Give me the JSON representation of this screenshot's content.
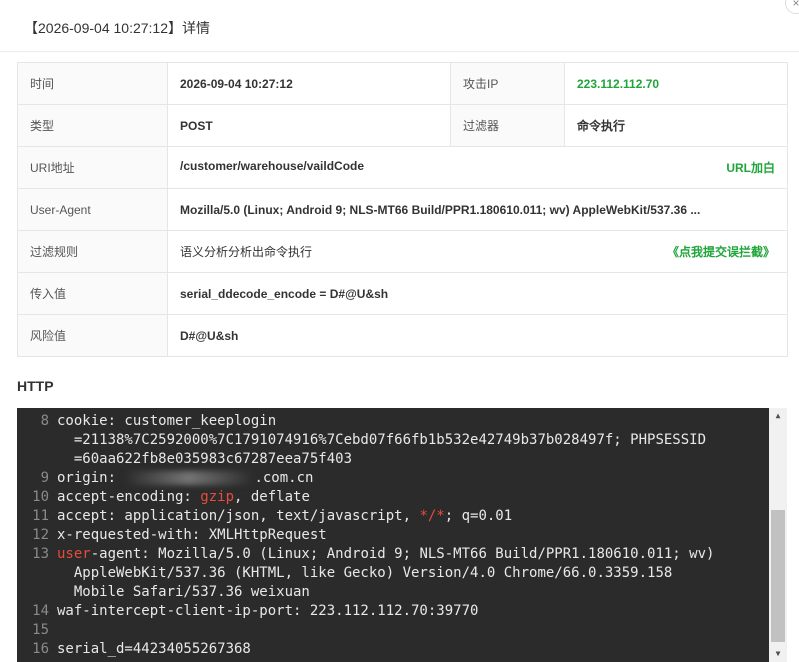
{
  "background": {
    "text": "..."
  },
  "modal": {
    "title": "【2026-09-04 10:27:12】详情",
    "close_icon": "×"
  },
  "details": {
    "time_label": "时间",
    "time_value": "2026-09-04 10:27:12",
    "attack_ip_label": "攻击IP",
    "attack_ip_value": "223.112.112.70",
    "type_label": "类型",
    "type_value": "POST",
    "filter_label": "过滤器",
    "filter_value": "命令执行",
    "uri_label": "URI地址",
    "uri_value": "/customer/warehouse/vaildCode",
    "uri_action": "URL加白",
    "ua_label": "User-Agent",
    "ua_value": "Mozilla/5.0 (Linux; Android 9; NLS-MT66 Build/PPR1.180610.011; wv) AppleWebKit/537.36 ...",
    "rule_label": "过滤规则",
    "rule_value": "语义分析分析出命令执行",
    "rule_action": "《点我提交误拦截》",
    "input_label": "传入值",
    "input_value": "serial_ddecode_encode = D#@U&sh",
    "risk_label": "风险值",
    "risk_value": "D#@U&sh"
  },
  "http": {
    "title": "HTTP",
    "lines": [
      {
        "n": "8",
        "text": "cookie: customer_keeplogin\n  =21138%7C2592000%7C1791074916%7Cebd07f66fb1b532e42749b37b028497f; PHPSESSID\n  =60aa622fb8e035983c67287eea75f403"
      },
      {
        "n": "9",
        "pre": "origin: ",
        "post": ".com.cn"
      },
      {
        "n": "10",
        "pre": "accept-encoding: ",
        "red": "gzip",
        "post": ", deflate"
      },
      {
        "n": "11",
        "pre": "accept: application/json, text/javascript, ",
        "red": "*/*",
        "post": "; q=0.01"
      },
      {
        "n": "12",
        "text": "x-requested-with: XMLHttpRequest"
      },
      {
        "n": "13",
        "red": "user",
        "post": "-agent: Mozilla/5.0 (Linux; Android 9; NLS-MT66 Build/PPR1.180610.011; wv)\n  AppleWebKit/537.36 (KHTML, like Gecko) Version/4.0 Chrome/66.0.3359.158\n  Mobile Safari/537.36 weixuan"
      },
      {
        "n": "14",
        "text": "waf-intercept-client-ip-port: 223.112.112.70:39770"
      },
      {
        "n": "15",
        "text": ""
      },
      {
        "n": "16",
        "text": "serial_d=44234055267368"
      }
    ]
  },
  "colors": {
    "accent_green": "#20a53a",
    "code_bg": "#2b2b2b",
    "keyword_red": "#e74c3c"
  }
}
